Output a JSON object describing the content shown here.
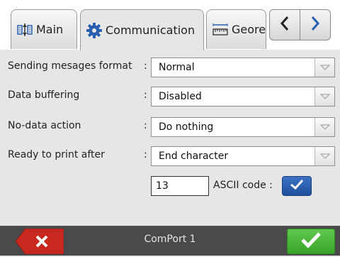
{
  "tabs": [
    {
      "label": "Main",
      "icon": "main-layout-icon"
    },
    {
      "label": "Communication",
      "icon": "gear-icon"
    },
    {
      "label": "Georeferencing",
      "icon": "ruler-icon"
    }
  ],
  "nav": {
    "prev_icon": "chevron-left-icon",
    "next_icon": "chevron-right-icon"
  },
  "settings": {
    "sending_format": {
      "label": "Sending mesages format",
      "value": "Normal"
    },
    "data_buffering": {
      "label": "Data buffering",
      "value": "Disabled"
    },
    "no_data_action": {
      "label": "No-data action",
      "value": "Do nothing"
    },
    "ready_to_print": {
      "label": "Ready to print after",
      "value": "End character"
    },
    "colon": ":"
  },
  "ascii": {
    "value": "13",
    "label": "ASCII code :",
    "checked": true
  },
  "footer": {
    "title": "ComPort 1"
  },
  "colors": {
    "footer_bg": "#4a4a4a",
    "cancel": "#c8281e",
    "ok": "#4ab53a",
    "checkbox": "#2a5fb0"
  }
}
